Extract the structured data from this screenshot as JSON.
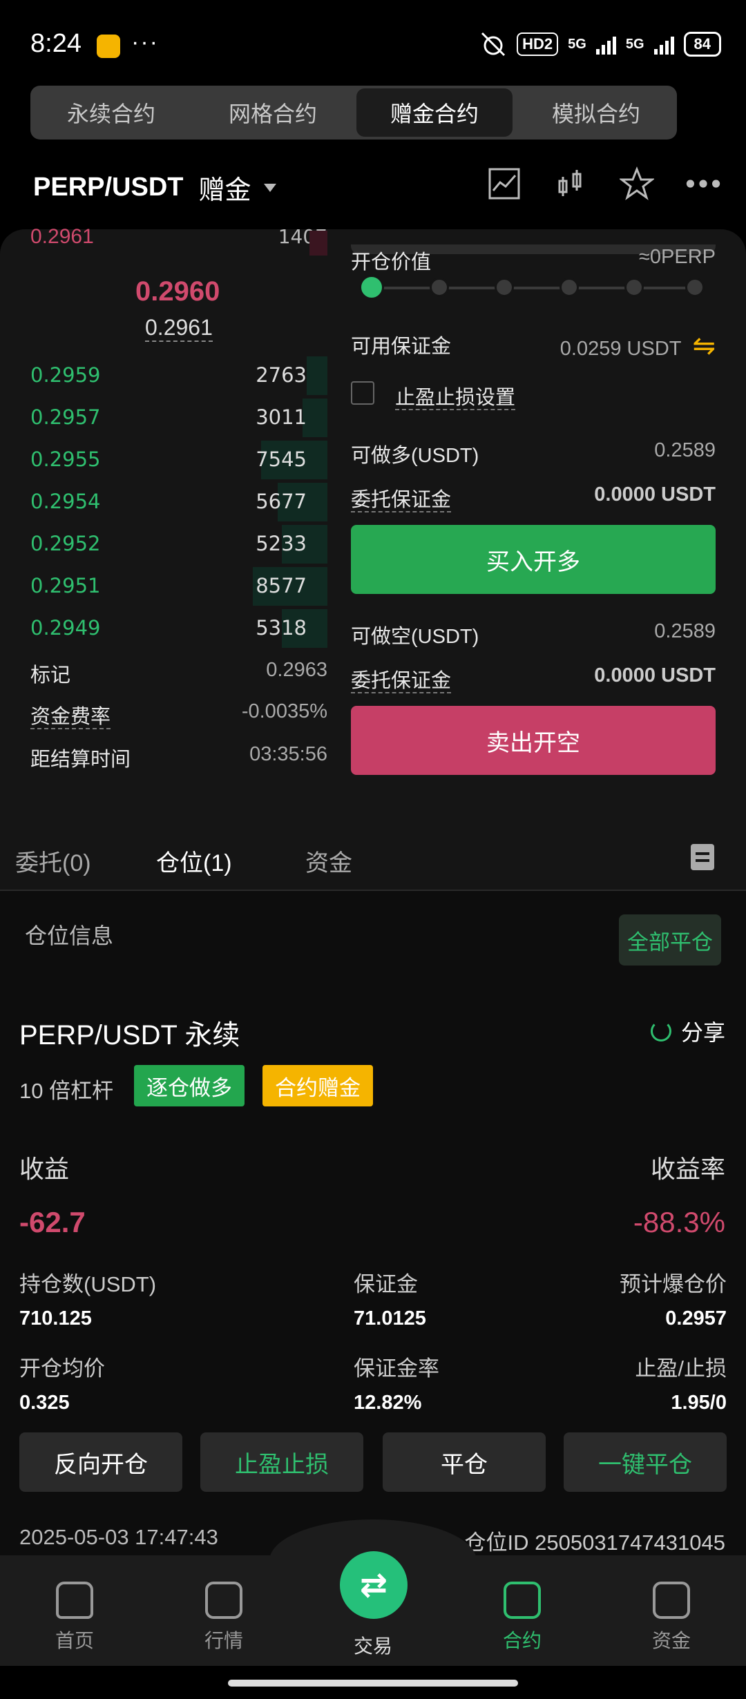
{
  "status": {
    "time": "8:24",
    "dots": "···",
    "hd": "HD2",
    "net1": "5G",
    "net2": "5G",
    "battery": "84"
  },
  "tabs": [
    "永续合约",
    "网格合约",
    "赠金合约",
    "模拟合约"
  ],
  "pair": {
    "name": "PERP/USDT",
    "mode": "赠金"
  },
  "orderbook": {
    "top_ask": {
      "price": "0.2961",
      "qty": "1407"
    },
    "mid_price": "0.2960",
    "mark_under": "0.2961",
    "bids": [
      {
        "price": "0.2959",
        "qty": "2763",
        "depth": 0.1
      },
      {
        "price": "0.2957",
        "qty": "3011",
        "depth": 0.12
      },
      {
        "price": "0.2955",
        "qty": "7545",
        "depth": 0.32
      },
      {
        "price": "0.2954",
        "qty": "5677",
        "depth": 0.24
      },
      {
        "price": "0.2952",
        "qty": "5233",
        "depth": 0.22
      },
      {
        "price": "0.2951",
        "qty": "8577",
        "depth": 0.36
      },
      {
        "price": "0.2949",
        "qty": "5318",
        "depth": 0.22
      }
    ],
    "mark_label": "标记",
    "mark_value": "0.2963",
    "funding_label": "资金费率",
    "funding_value": "-0.0035%",
    "settle_label": "距结算时间",
    "settle_value": "03:35:56"
  },
  "form": {
    "open_value_label": "开仓价值",
    "open_value": "≈0PERP",
    "avail_label": "可用保证金",
    "avail_value": "0.0259 USDT",
    "tpsl_label": "止盈止损设置",
    "long_label": "可做多(USDT)",
    "long_value": "0.2589",
    "margin_label": "委托保证金",
    "margin_value": "0.0000 USDT",
    "buy_label": "买入开多",
    "short_label": "可做空(USDT)",
    "short_value": "0.2589",
    "margin2_label": "委托保证金",
    "margin2_value": "0.0000 USDT",
    "sell_label": "卖出开空"
  },
  "pos_tabs": {
    "orders": "委托(0)",
    "positions": "仓位(1)",
    "funds": "资金"
  },
  "position": {
    "info_label": "仓位信息",
    "close_all": "全部平仓",
    "title": "PERP/USDT 永续",
    "share": "分享",
    "leverage": "10 倍杠杆",
    "tag1": "逐仓做多",
    "tag2": "合约赠金",
    "pnl_label": "收益",
    "pnl_rate_label": "收益率",
    "pnl": "-62.7",
    "pnl_rate": "-88.3%",
    "size_label": "持仓数(USDT)",
    "size": "710.125",
    "margin_label": "保证金",
    "margin": "71.0125",
    "liq_label": "预计爆仓价",
    "liq": "0.2957",
    "entry_label": "开仓均价",
    "entry": "0.325",
    "mratio_label": "保证金率",
    "mratio": "12.82%",
    "tpsl_label": "止盈/止损",
    "tpsl": "1.95/0",
    "btn_reverse": "反向开仓",
    "btn_tpsl": "止盈止损",
    "btn_close": "平仓",
    "btn_quick": "一键平仓",
    "time": "2025-05-03 17:47:43",
    "id": "仓位ID 2505031747431045"
  },
  "nav": {
    "home": "首页",
    "market": "行情",
    "trade": "交易",
    "contract": "合约",
    "assets": "资金"
  },
  "colors": {
    "green": "#2fbf6f",
    "red": "#d04a6d",
    "yellow": "#f5b400"
  }
}
